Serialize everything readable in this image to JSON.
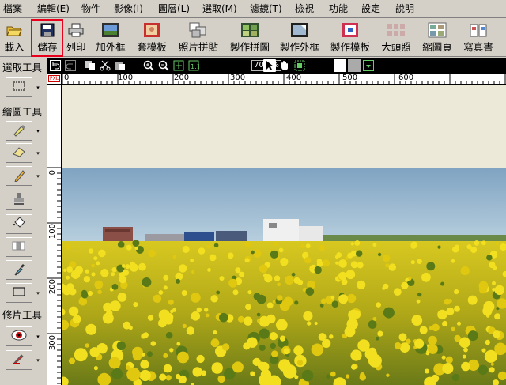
{
  "menu": [
    {
      "label": "檔案"
    },
    {
      "label": "編輯(E)"
    },
    {
      "label": "物件"
    },
    {
      "label": "影像(I)"
    },
    {
      "label": "圖層(L)"
    },
    {
      "label": "選取(M)"
    },
    {
      "label": "濾鏡(T)"
    },
    {
      "label": "檢視"
    },
    {
      "label": "功能"
    },
    {
      "label": "設定"
    },
    {
      "label": "說明"
    }
  ],
  "toolbar": {
    "buttons": [
      {
        "label": "載入",
        "icon": "open-folder-icon"
      },
      {
        "label": "儲存",
        "icon": "floppy-disk-icon",
        "highlighted": true
      },
      {
        "label": "列印",
        "icon": "printer-icon"
      },
      {
        "label": "加外框",
        "icon": "add-frame-icon"
      },
      {
        "label": "套模板",
        "icon": "apply-template-icon"
      },
      {
        "label": "照片拼貼",
        "icon": "photo-collage-icon"
      },
      {
        "label": "製作拼圖",
        "icon": "make-puzzle-icon"
      },
      {
        "label": "製作外框",
        "icon": "make-frame-icon"
      },
      {
        "label": "製作模板",
        "icon": "make-template-icon"
      },
      {
        "label": "大頭照",
        "icon": "passport-photo-icon"
      },
      {
        "label": "縮圖頁",
        "icon": "thumbnail-page-icon"
      },
      {
        "label": "寫真書",
        "icon": "photo-book-icon"
      }
    ]
  },
  "canvas_toolbar": {
    "zoom": "70.9%",
    "icons": [
      "undo-icon",
      "redo-icon",
      "copy-icon",
      "cut-icon",
      "paste-icon",
      "zoom-in-icon",
      "zoom-out-icon",
      "fit-window-icon",
      "actual-size-icon",
      "pointer-icon",
      "hand-icon",
      "select-object-icon"
    ]
  },
  "left_panel": {
    "select_title": "選取工具",
    "draw_title": "繪圖工具",
    "retouch_title": "修片工具"
  },
  "ruler": {
    "corner_label": "PXL",
    "h_labels": [
      "0",
      "100",
      "200",
      "300",
      "400",
      "500",
      "600"
    ],
    "v_labels": [
      "0",
      "100",
      "200",
      "300"
    ]
  },
  "colors": {
    "highlight": "#e8001c",
    "panel": "#d4d0c8",
    "workspace": "#ece9d8",
    "sky": "#8fb1cb",
    "flowers": "#e8d81a"
  }
}
